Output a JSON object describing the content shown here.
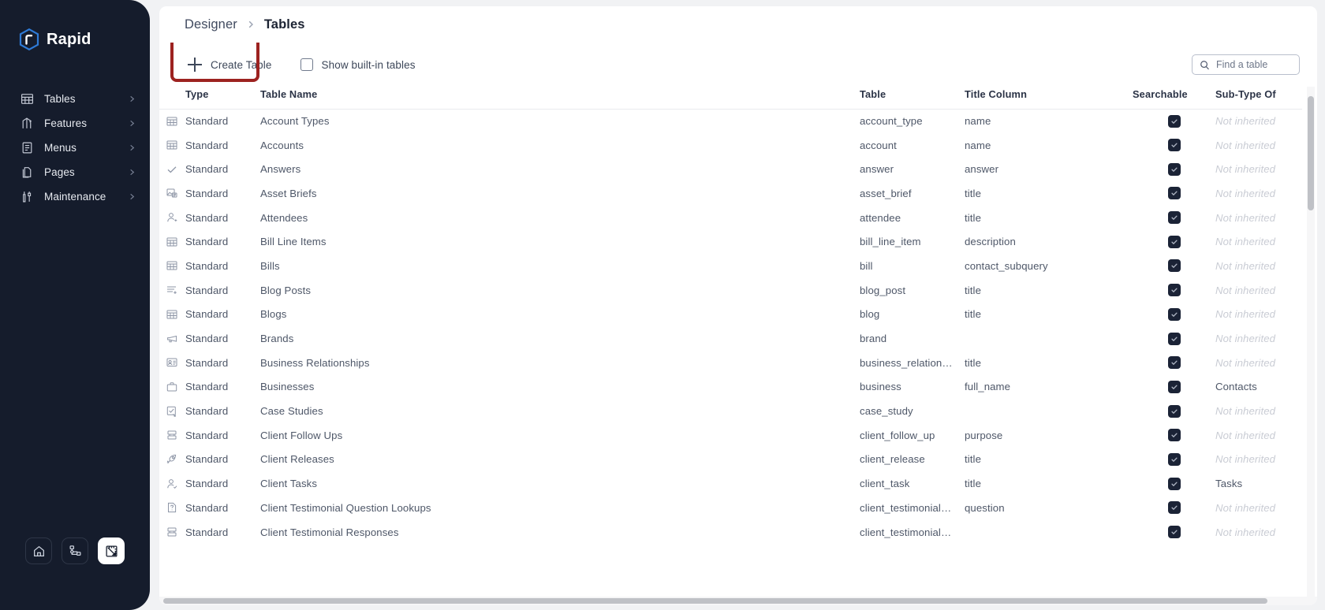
{
  "sidebar": {
    "brand": "Rapid",
    "items": [
      {
        "label": "Tables",
        "icon": "table-grid-icon"
      },
      {
        "label": "Features",
        "icon": "feature-flag-icon"
      },
      {
        "label": "Menus",
        "icon": "menu-list-icon"
      },
      {
        "label": "Pages",
        "icon": "pages-copy-icon"
      },
      {
        "label": "Maintenance",
        "icon": "maintenance-tools-icon"
      }
    ],
    "bottom_buttons": [
      {
        "name": "home-button",
        "icon": "home-icon",
        "active": false
      },
      {
        "name": "sitemap-button",
        "icon": "sitemap-icon",
        "active": false
      },
      {
        "name": "designer-button",
        "icon": "ruler-icon",
        "active": true
      }
    ]
  },
  "breadcrumb": {
    "parent": "Designer",
    "current": "Tables"
  },
  "toolbar": {
    "create_label": "Create Table",
    "show_builtin_label": "Show built-in tables",
    "show_builtin_checked": false,
    "search_placeholder": "Find a table",
    "search_value": "",
    "highlight_color": "#9d2220"
  },
  "table": {
    "columns": [
      "Type",
      "Table Name",
      "Table",
      "Title Column",
      "Searchable",
      "Sub-Type Of"
    ],
    "not_inherited_label": "Not inherited",
    "rows": [
      {
        "icon": "table-grid-icon",
        "type": "Standard",
        "name": "Account Types",
        "table": "account_type",
        "title": "name",
        "searchable": true,
        "sub": ""
      },
      {
        "icon": "table-grid-icon",
        "type": "Standard",
        "name": "Accounts",
        "table": "account",
        "title": "name",
        "searchable": true,
        "sub": ""
      },
      {
        "icon": "check-icon",
        "type": "Standard",
        "name": "Answers",
        "table": "answer",
        "title": "answer",
        "searchable": true,
        "sub": ""
      },
      {
        "icon": "image-card-icon",
        "type": "Standard",
        "name": "Asset Briefs",
        "table": "asset_brief",
        "title": "title",
        "searchable": true,
        "sub": ""
      },
      {
        "icon": "person-add-icon",
        "type": "Standard",
        "name": "Attendees",
        "table": "attendee",
        "title": "title",
        "searchable": true,
        "sub": ""
      },
      {
        "icon": "table-grid-icon",
        "type": "Standard",
        "name": "Bill Line Items",
        "table": "bill_line_item",
        "title": "description",
        "searchable": true,
        "sub": ""
      },
      {
        "icon": "table-grid-icon",
        "type": "Standard",
        "name": "Bills",
        "table": "bill",
        "title": "contact_subquery",
        "searchable": true,
        "sub": ""
      },
      {
        "icon": "list-add-icon",
        "type": "Standard",
        "name": "Blog Posts",
        "table": "blog_post",
        "title": "title",
        "searchable": true,
        "sub": ""
      },
      {
        "icon": "table-grid-icon",
        "type": "Standard",
        "name": "Blogs",
        "table": "blog",
        "title": "title",
        "searchable": true,
        "sub": ""
      },
      {
        "icon": "megaphone-icon",
        "type": "Standard",
        "name": "Brands",
        "table": "brand",
        "title": "",
        "searchable": true,
        "sub": ""
      },
      {
        "icon": "id-card-icon",
        "type": "Standard",
        "name": "Business Relationships",
        "table": "business_relationshi…",
        "title": "title",
        "searchable": true,
        "sub": ""
      },
      {
        "icon": "briefcase-icon",
        "type": "Standard",
        "name": "Businesses",
        "table": "business",
        "title": "full_name",
        "searchable": true,
        "sub": "Contacts"
      },
      {
        "icon": "checkbox-doc-icon",
        "type": "Standard",
        "name": "Case Studies",
        "table": "case_study",
        "title": "",
        "searchable": true,
        "sub": ""
      },
      {
        "icon": "stack-icon",
        "type": "Standard",
        "name": "Client Follow Ups",
        "table": "client_follow_up",
        "title": "purpose",
        "searchable": true,
        "sub": ""
      },
      {
        "icon": "rocket-icon",
        "type": "Standard",
        "name": "Client Releases",
        "table": "client_release",
        "title": "title",
        "searchable": true,
        "sub": ""
      },
      {
        "icon": "person-check-icon",
        "type": "Standard",
        "name": "Client Tasks",
        "table": "client_task",
        "title": "title",
        "searchable": true,
        "sub": "Tasks"
      },
      {
        "icon": "question-doc-icon",
        "type": "Standard",
        "name": "Client Testimonial Question Lookups",
        "table": "client_testimonial_…",
        "title": "question",
        "searchable": true,
        "sub": ""
      },
      {
        "icon": "stack-icon",
        "type": "Standard",
        "name": "Client Testimonial Responses",
        "table": "client_testimonial_r…",
        "title": "",
        "searchable": true,
        "sub": ""
      }
    ]
  }
}
